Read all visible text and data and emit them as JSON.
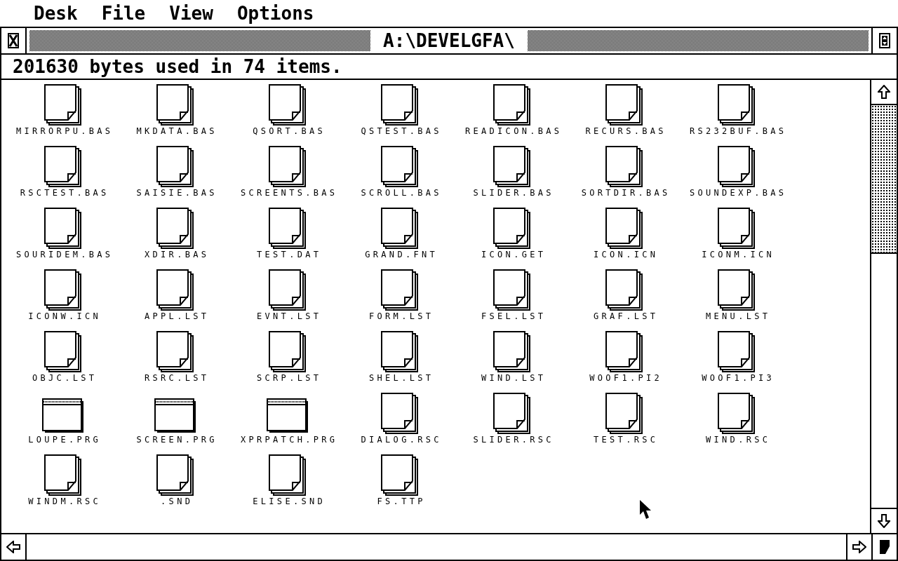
{
  "menu": [
    "Desk",
    "File",
    "View",
    "Options"
  ],
  "window": {
    "title": "A:\\DEVELGFA\\",
    "info": "201630 bytes used in 74 items."
  },
  "files": [
    {
      "name": "MIRRORPU.BAS",
      "kind": "doc"
    },
    {
      "name": "MKDATA.BAS",
      "kind": "doc"
    },
    {
      "name": "QSORT.BAS",
      "kind": "doc"
    },
    {
      "name": "QSTEST.BAS",
      "kind": "doc"
    },
    {
      "name": "READICON.BAS",
      "kind": "doc"
    },
    {
      "name": "RECURS.BAS",
      "kind": "doc"
    },
    {
      "name": "RS232BUF.BAS",
      "kind": "doc"
    },
    {
      "name": "RSCTEST.BAS",
      "kind": "doc"
    },
    {
      "name": "SAISIE.BAS",
      "kind": "doc"
    },
    {
      "name": "SCREENTS.BAS",
      "kind": "doc"
    },
    {
      "name": "SCROLL.BAS",
      "kind": "doc"
    },
    {
      "name": "SLIDER.BAS",
      "kind": "doc"
    },
    {
      "name": "SORTDIR.BAS",
      "kind": "doc"
    },
    {
      "name": "SOUNDEXP.BAS",
      "kind": "doc"
    },
    {
      "name": "SOURIDEM.BAS",
      "kind": "doc"
    },
    {
      "name": "XDIR.BAS",
      "kind": "doc"
    },
    {
      "name": "TEST.DAT",
      "kind": "doc"
    },
    {
      "name": "GRAND.FNT",
      "kind": "doc"
    },
    {
      "name": "ICON.GET",
      "kind": "doc"
    },
    {
      "name": "ICON.ICN",
      "kind": "doc"
    },
    {
      "name": "ICONM.ICN",
      "kind": "doc"
    },
    {
      "name": "ICONW.ICN",
      "kind": "doc"
    },
    {
      "name": "APPL.LST",
      "kind": "doc"
    },
    {
      "name": "EVNT.LST",
      "kind": "doc"
    },
    {
      "name": "FORM.LST",
      "kind": "doc"
    },
    {
      "name": "FSEL.LST",
      "kind": "doc"
    },
    {
      "name": "GRAF.LST",
      "kind": "doc"
    },
    {
      "name": "MENU.LST",
      "kind": "doc"
    },
    {
      "name": "OBJC.LST",
      "kind": "doc"
    },
    {
      "name": "RSRC.LST",
      "kind": "doc"
    },
    {
      "name": "SCRP.LST",
      "kind": "doc"
    },
    {
      "name": "SHEL.LST",
      "kind": "doc"
    },
    {
      "name": "WIND.LST",
      "kind": "doc"
    },
    {
      "name": "WOOF1.PI2",
      "kind": "doc"
    },
    {
      "name": "WOOF1.PI3",
      "kind": "doc"
    },
    {
      "name": "LOUPE.PRG",
      "kind": "prg"
    },
    {
      "name": "SCREEN.PRG",
      "kind": "prg"
    },
    {
      "name": "XPRPATCH.PRG",
      "kind": "prg"
    },
    {
      "name": "DIALOG.RSC",
      "kind": "doc"
    },
    {
      "name": "SLIDER.RSC",
      "kind": "doc"
    },
    {
      "name": "TEST.RSC",
      "kind": "doc"
    },
    {
      "name": "WIND.RSC",
      "kind": "doc"
    },
    {
      "name": "WINDM.RSC",
      "kind": "doc"
    },
    {
      "name": ".SND",
      "kind": "doc"
    },
    {
      "name": "ELISE.SND",
      "kind": "doc"
    },
    {
      "name": "FS.TTP",
      "kind": "doc"
    }
  ]
}
